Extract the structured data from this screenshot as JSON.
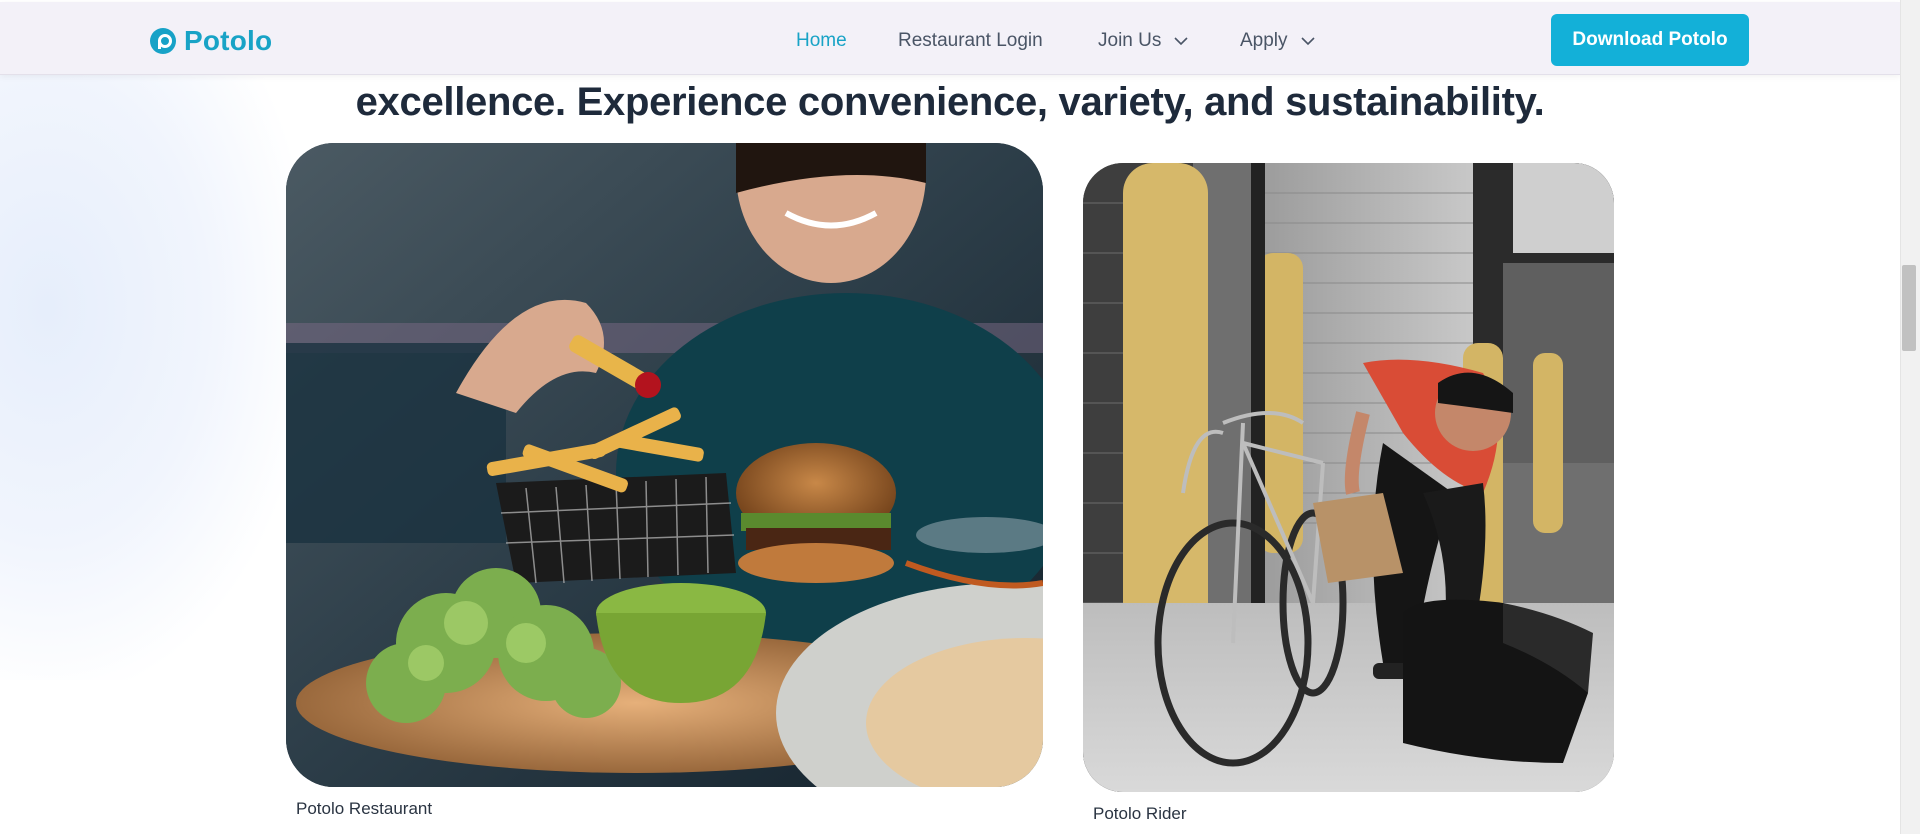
{
  "brand": {
    "name": "Potolo",
    "color": "#18a3c6"
  },
  "nav": {
    "items": [
      {
        "label": "Home",
        "active": true,
        "has_dropdown": false
      },
      {
        "label": "Restaurant Login",
        "active": false,
        "has_dropdown": false
      },
      {
        "label": "Join Us",
        "active": false,
        "has_dropdown": true
      },
      {
        "label": "Apply",
        "active": false,
        "has_dropdown": true
      }
    ],
    "cta_label": "Download Potolo",
    "cta_color": "#13b0d8"
  },
  "hero": {
    "headline": "excellence. Experience convenience, variety, and sustainability."
  },
  "cards": [
    {
      "caption": "Potolo Restaurant",
      "image": "woman-eating-fries-burger-salad-photo"
    },
    {
      "caption": "Potolo Rider",
      "image": "courier-with-bicycle-and-bag-photo"
    }
  ],
  "icons": {
    "dropdown": "chevron-down-icon",
    "logo": "potolo-logo-icon"
  }
}
